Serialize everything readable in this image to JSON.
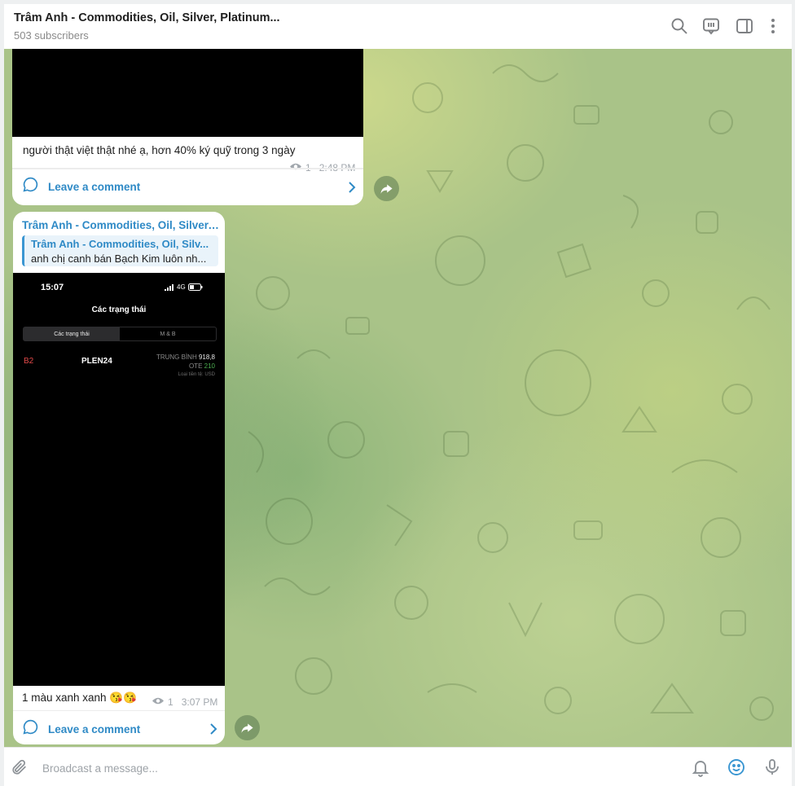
{
  "header": {
    "title": "Trâm Anh - Commodities, Oil, Silver, Platinum...",
    "subscribers": "503 subscribers"
  },
  "messages": [
    {
      "caption": "người thật việt thật nhé ạ, hơn 40% ký quỹ trong 3 ngày",
      "views": "1",
      "time": "2:48 PM",
      "comment_label": "Leave a comment"
    },
    {
      "author": "Trâm Anh - Commodities, Oil, Silver, ...",
      "reply_author": "Trâm Anh - Commodities, Oil, Silv...",
      "reply_text": "anh chị canh bán Bạch Kim luôn nh...",
      "caption": "1 màu xanh xanh 😘😘",
      "views": "1",
      "time": "3:07 PM",
      "comment_label": "Leave a comment",
      "screenshot": {
        "time": "15:07",
        "network": "4G",
        "title": "Các trạng thái",
        "tabs": [
          "Các trạng thái",
          "M & B"
        ],
        "row_side": "B2",
        "row_symbol": "PLEN24",
        "avg_label": "TRUNG BÌNH",
        "avg_value": "918,8",
        "ote_label": "OTE",
        "ote_value": "210",
        "currency_note": "Loại tiền tệ: USD"
      }
    }
  ],
  "composer": {
    "placeholder": "Broadcast a message..."
  },
  "colors": {
    "link": "#2f8ac6",
    "accent": "#3a96d2"
  }
}
